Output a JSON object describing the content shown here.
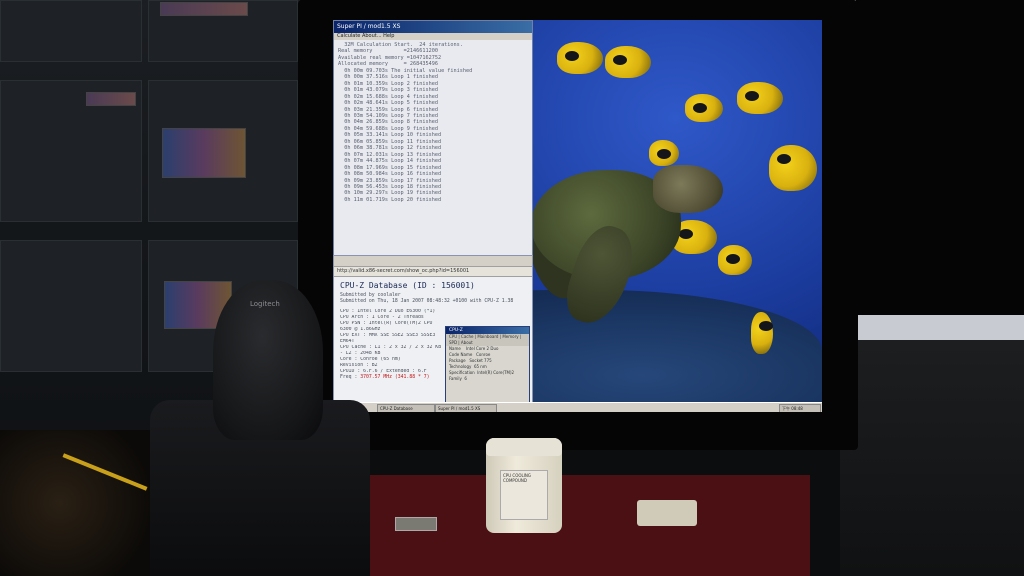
{
  "window_log": {
    "title": "Super PI / mod1.5 XS",
    "menu": "Calculate  About...  Help",
    "lines": [
      "  32M Calculation Start.  24 iterations.",
      "Real memory          =2146611200",
      "Available real memory =1047162752",
      "Allocated memory     = 268435496",
      "  0h 00m 09.703s The initial value finished",
      "  0h 00m 37.516s Loop 1 finished",
      "  0h 01m 10.359s Loop 2 finished",
      "  0h 01m 43.079s Loop 3 finished",
      "  0h 02m 15.688s Loop 4 finished",
      "  0h 02m 48.641s Loop 5 finished",
      "  0h 03m 21.359s Loop 6 finished",
      "  0h 03m 54.109s Loop 7 finished",
      "  0h 04m 26.859s Loop 8 finished",
      "  0h 04m 59.688s Loop 9 finished",
      "  0h 05m 33.141s Loop 10 finished",
      "  0h 06m 05.859s Loop 11 finished",
      "  0h 06m 38.781s Loop 12 finished",
      "  0h 07m 12.031s Loop 13 finished",
      "  0h 07m 44.875s Loop 14 finished",
      "  0h 08m 17.969s Loop 15 finished",
      "  0h 08m 50.984s Loop 16 finished",
      "  0h 09m 23.859s Loop 17 finished",
      "  0h 09m 56.453s Loop 18 finished",
      "  0h 10m 29.297s Loop 19 finished",
      "  0h 11m 01.719s Loop 20 finished"
    ]
  },
  "browser": {
    "address": "http://valid.x86-secret.com/show_oc.php?id=156001",
    "heading": "CPU-Z Database (ID : 156001)",
    "submitted_by": "Submitted by coolaler",
    "submitted_on": "Submitted on Thu, 18 Jan 2007 08:48:32 +0100 with CPU-Z 1.38",
    "specs": [
      "CPU : Intel Core 2 Duo E6300 (*1)",
      "CPU Arch : 1 Core - 2 Threads",
      "CPU PSN : Intel(R) Core(TM)2 CPU",
      "6300 @ 1.86GHz",
      "CPU EXT : MMX SSE SSE2 SSE3 SSSE3",
      "EM64T",
      "CPU Cache : L1 : 2 x 32 / 2 x 32 KB",
      "- L2 : 2048 KB",
      "Core : Conroe (65 nm)",
      "Revision : B2",
      "CPUID : 6.F.6 / Extended : 6.F"
    ],
    "freq_label": "Freq : ",
    "freq_value": "3707.57 MHz (341.88 * 7)"
  },
  "cpuz": {
    "title": "CPU-Z",
    "tabs": "CPU | Cache | Mainboard | Memory | SPD | About",
    "rows": [
      "Name    Intel Core 2 Duo",
      "Code Name   Conroe",
      "Package   Socket 775",
      "Technology  65 nm",
      "Specification  Intel(R) Core(TM)2",
      "Family  6"
    ]
  },
  "taskbar": {
    "items": [
      "CPU-Z Database",
      "Super PI / mod1.5 XS"
    ],
    "clock": "下午 08:48"
  },
  "objects": {
    "chair_brand": "Logitech",
    "jar_label": "CPU COOLING COMPOUND"
  }
}
